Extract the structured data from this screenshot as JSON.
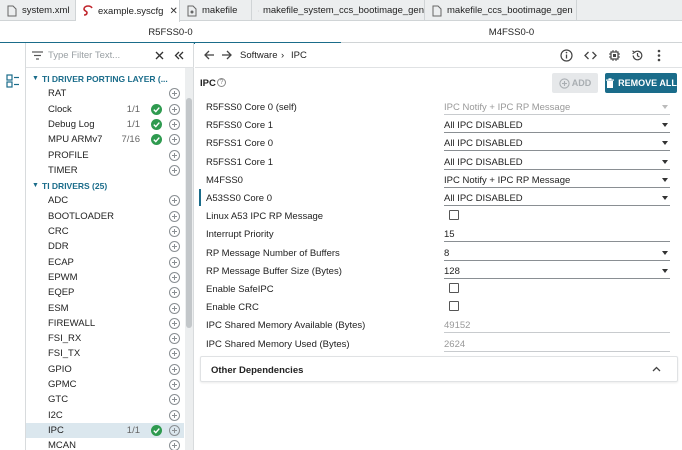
{
  "file_tabs": [
    {
      "label": "system.xml",
      "active": false,
      "icon": "file-icon"
    },
    {
      "label": "example.syscfg",
      "active": true,
      "icon": "syscfg-icon"
    },
    {
      "label": "makefile",
      "active": false,
      "icon": "file-icon"
    },
    {
      "label": "makefile_system_ccs_bootimage_gen",
      "active": false,
      "icon": "file-icon"
    },
    {
      "label": "makefile_ccs_bootimage_gen",
      "active": false,
      "icon": "file-icon"
    }
  ],
  "close_glyph": "✕",
  "core_tabs": [
    {
      "label": "R5FSS0-0",
      "active": true
    },
    {
      "label": "M4FSS0-0",
      "active": false
    }
  ],
  "filter": {
    "placeholder": "Type Filter Text..."
  },
  "tree": {
    "groups": [
      {
        "label": "TI DRIVER PORTING LAYER (...",
        "items": [
          {
            "label": "RAT",
            "count": "",
            "checked": false
          },
          {
            "label": "Clock",
            "count": "1/1",
            "checked": true
          },
          {
            "label": "Debug Log",
            "count": "1/1",
            "checked": true
          },
          {
            "label": "MPU ARMv7",
            "count": "7/16",
            "checked": true
          },
          {
            "label": "PROFILE",
            "count": "",
            "checked": false
          },
          {
            "label": "TIMER",
            "count": "",
            "checked": false
          }
        ]
      },
      {
        "label": "TI DRIVERS (25)",
        "items": [
          {
            "label": "ADC",
            "count": "",
            "checked": false
          },
          {
            "label": "BOOTLOADER",
            "count": "",
            "checked": false
          },
          {
            "label": "CRC",
            "count": "",
            "checked": false
          },
          {
            "label": "DDR",
            "count": "",
            "checked": false
          },
          {
            "label": "ECAP",
            "count": "",
            "checked": false
          },
          {
            "label": "EPWM",
            "count": "",
            "checked": false
          },
          {
            "label": "EQEP",
            "count": "",
            "checked": false
          },
          {
            "label": "ESM",
            "count": "",
            "checked": false
          },
          {
            "label": "FIREWALL",
            "count": "",
            "checked": false
          },
          {
            "label": "FSI_RX",
            "count": "",
            "checked": false
          },
          {
            "label": "FSI_TX",
            "count": "",
            "checked": false
          },
          {
            "label": "GPIO",
            "count": "",
            "checked": false
          },
          {
            "label": "GPMC",
            "count": "",
            "checked": false
          },
          {
            "label": "GTC",
            "count": "",
            "checked": false
          },
          {
            "label": "I2C",
            "count": "",
            "checked": false
          },
          {
            "label": "IPC",
            "count": "1/1",
            "checked": true,
            "selected": true
          },
          {
            "label": "MCAN",
            "count": "",
            "checked": false
          }
        ]
      }
    ]
  },
  "breadcrumb": {
    "parent": "Software",
    "sep": "›",
    "current": "IPC"
  },
  "module": {
    "title": "IPC",
    "help_glyph": "?",
    "add_label": "ADD",
    "remove_label": "REMOVE ALL"
  },
  "config_rows": [
    {
      "label": "R5FSS0 Core 0 (self)",
      "type": "select",
      "value": "IPC Notify + IPC RP Message",
      "disabled": true
    },
    {
      "label": "R5FSS0 Core 1",
      "type": "select",
      "value": "All IPC DISABLED",
      "disabled": false
    },
    {
      "label": "R5FSS1 Core 0",
      "type": "select",
      "value": "All IPC DISABLED",
      "disabled": false
    },
    {
      "label": "R5FSS1 Core 1",
      "type": "select",
      "value": "All IPC DISABLED",
      "disabled": false
    },
    {
      "label": "M4FSS0",
      "type": "select",
      "value": "IPC Notify + IPC RP Message",
      "disabled": false
    },
    {
      "label": "A53SS0 Core 0",
      "type": "select",
      "value": "All IPC DISABLED",
      "disabled": false,
      "marked": true
    },
    {
      "label": "Linux A53 IPC RP Message",
      "type": "checkbox",
      "checked": false
    },
    {
      "label": "Interrupt Priority",
      "type": "text",
      "value": "15",
      "disabled": false
    },
    {
      "label": "RP Message Number of Buffers",
      "type": "select",
      "value": "8",
      "disabled": false
    },
    {
      "label": "RP Message Buffer Size (Bytes)",
      "type": "select",
      "value": "128",
      "disabled": false
    },
    {
      "label": "Enable SafeIPC",
      "type": "checkbox",
      "checked": false
    },
    {
      "label": "Enable CRC",
      "type": "checkbox",
      "checked": false
    },
    {
      "label": "IPC Shared Memory Available (Bytes)",
      "type": "text",
      "value": "49152",
      "disabled": true
    },
    {
      "label": "IPC Shared Memory Used (Bytes)",
      "type": "text",
      "value": "2624",
      "disabled": true
    }
  ],
  "other_dependencies": {
    "label": "Other Dependencies",
    "chevron": "^"
  },
  "colors": {
    "accent": "#1a6c8a",
    "check_green": "#2e9a4f"
  }
}
